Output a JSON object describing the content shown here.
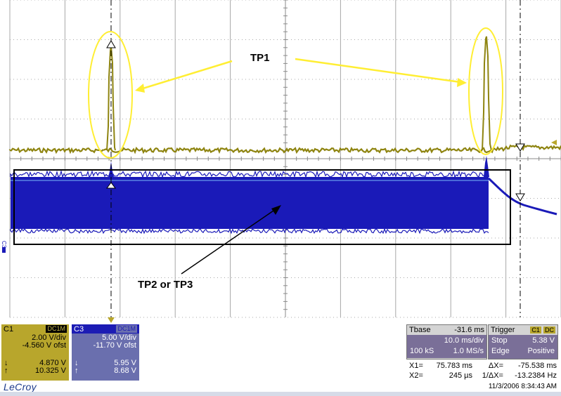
{
  "annotations": {
    "tp1": "TP1",
    "tp2_tp3": "TP2 or TP3"
  },
  "channel_markers": {
    "c3_offset": "C3"
  },
  "colors": {
    "c1_trace": "#8e8410",
    "c3_trace": "#1a1ab8",
    "grid": "#a8a8a8",
    "annotation": "#ffee33"
  },
  "c1": {
    "name": "C1",
    "coupling": "DC1M",
    "vdiv": "2.00 V/div",
    "offset": "-4.560 V ofst",
    "down_val": "4.870 V",
    "up_val": "10.325 V",
    "down_arrow": "↓",
    "up_arrow": "↑"
  },
  "c3": {
    "name": "C3",
    "coupling": "DC1M",
    "vdiv": "5.00 V/div",
    "offset": "-11.70 V ofst",
    "down_val": "5.95 V",
    "up_val": "8.68 V",
    "down_arrow": "↓",
    "up_arrow": "↑"
  },
  "timebase": {
    "label": "Tbase",
    "delay": "-31.6 ms",
    "tdiv": "10.0 ms/div",
    "samples": "100 kS",
    "rate": "1.0 MS/s"
  },
  "trigger": {
    "label": "Trigger",
    "source": "C1",
    "coupling": "DC",
    "mode": "Stop",
    "level": "5.38 V",
    "type": "Edge",
    "slope": "Positive"
  },
  "cursors": {
    "x1_label": "X1=",
    "x1_val": "75.783 ms",
    "dx_label": "ΔX=",
    "dx_val": "-75.538 ms",
    "x2_label": "X2=",
    "x2_val": "245 µs",
    "inv_label": "1/ΔX=",
    "inv_val": "-13.2384 Hz"
  },
  "timestamp": "11/3/2006 8:34:43 AM",
  "brand": "LeCroy"
}
